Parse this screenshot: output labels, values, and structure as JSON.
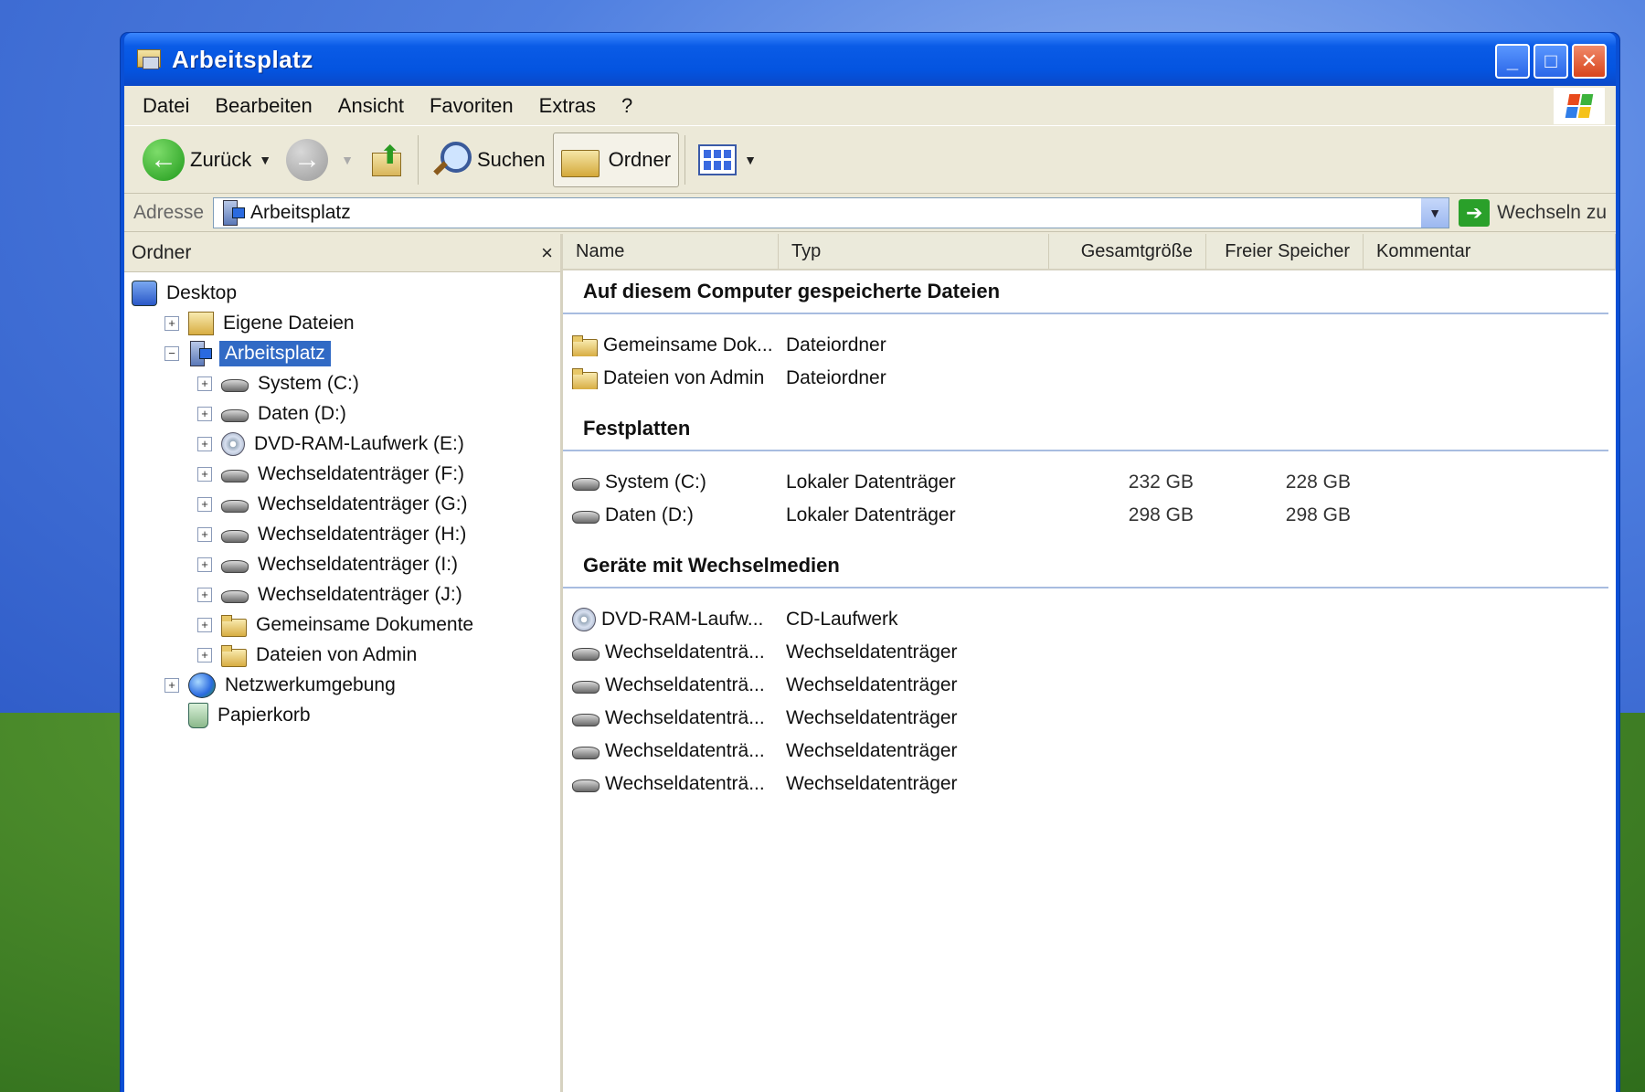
{
  "window": {
    "title": "Arbeitsplatz"
  },
  "menu": [
    "Datei",
    "Bearbeiten",
    "Ansicht",
    "Favoriten",
    "Extras",
    "?"
  ],
  "toolbar": {
    "back": "Zurück",
    "search": "Suchen",
    "folders": "Ordner"
  },
  "address": {
    "label": "Adresse",
    "value": "Arbeitsplatz",
    "go": "Wechseln zu"
  },
  "tree": {
    "header": "Ordner",
    "close": "×",
    "items": [
      {
        "label": "Desktop",
        "icon": "desktop-icon",
        "level": 0,
        "expander": ""
      },
      {
        "label": "Eigene Dateien",
        "icon": "my-documents-icon",
        "level": 1,
        "expander": "+"
      },
      {
        "label": "Arbeitsplatz",
        "icon": "my-computer-icon",
        "level": 1,
        "expander": "−",
        "selected": true
      },
      {
        "label": "System (C:)",
        "icon": "drive-icon",
        "level": 2,
        "expander": "+"
      },
      {
        "label": "Daten (D:)",
        "icon": "drive-icon",
        "level": 2,
        "expander": "+"
      },
      {
        "label": "DVD-RAM-Laufwerk (E:)",
        "icon": "cd-drive-icon",
        "level": 2,
        "expander": "+"
      },
      {
        "label": "Wechseldatenträger (F:)",
        "icon": "drive-icon",
        "level": 2,
        "expander": "+"
      },
      {
        "label": "Wechseldatenträger (G:)",
        "icon": "drive-icon",
        "level": 2,
        "expander": "+"
      },
      {
        "label": "Wechseldatenträger (H:)",
        "icon": "drive-icon",
        "level": 2,
        "expander": "+"
      },
      {
        "label": "Wechseldatenträger (I:)",
        "icon": "drive-icon",
        "level": 2,
        "expander": "+"
      },
      {
        "label": "Wechseldatenträger (J:)",
        "icon": "drive-icon",
        "level": 2,
        "expander": "+"
      },
      {
        "label": "Gemeinsame Dokumente",
        "icon": "folder-icon",
        "level": 2,
        "expander": "+"
      },
      {
        "label": "Dateien von Admin",
        "icon": "folder-icon",
        "level": 2,
        "expander": "+"
      },
      {
        "label": "Netzwerkumgebung",
        "icon": "network-icon",
        "level": 1,
        "expander": "+"
      },
      {
        "label": "Papierkorb",
        "icon": "recycle-bin-icon",
        "level": 1,
        "expander": ""
      }
    ]
  },
  "list": {
    "columns": [
      "Name",
      "Typ",
      "Gesamtgröße",
      "Freier Speicher",
      "Kommentar"
    ],
    "groups": [
      {
        "title": "Auf diesem Computer gespeicherte Dateien",
        "rows": [
          {
            "name": "Gemeinsame Dok...",
            "type": "Dateiordner",
            "size": "",
            "free": "",
            "icon": "folder-icon"
          },
          {
            "name": "Dateien von Admin",
            "type": "Dateiordner",
            "size": "",
            "free": "",
            "icon": "folder-icon"
          }
        ]
      },
      {
        "title": "Festplatten",
        "rows": [
          {
            "name": "System (C:)",
            "type": "Lokaler Datenträger",
            "size": "232 GB",
            "free": "228 GB",
            "icon": "drive-icon"
          },
          {
            "name": "Daten (D:)",
            "type": "Lokaler Datenträger",
            "size": "298 GB",
            "free": "298 GB",
            "icon": "drive-icon"
          }
        ]
      },
      {
        "title": "Geräte mit Wechselmedien",
        "rows": [
          {
            "name": "DVD-RAM-Laufw...",
            "type": "CD-Laufwerk",
            "size": "",
            "free": "",
            "icon": "cd-drive-icon"
          },
          {
            "name": "Wechseldatenträ...",
            "type": "Wechseldatenträger",
            "size": "",
            "free": "",
            "icon": "drive-icon"
          },
          {
            "name": "Wechseldatenträ...",
            "type": "Wechseldatenträger",
            "size": "",
            "free": "",
            "icon": "drive-icon"
          },
          {
            "name": "Wechseldatenträ...",
            "type": "Wechseldatenträger",
            "size": "",
            "free": "",
            "icon": "drive-icon"
          },
          {
            "name": "Wechseldatenträ...",
            "type": "Wechseldatenträger",
            "size": "",
            "free": "",
            "icon": "drive-icon"
          },
          {
            "name": "Wechseldatenträ...",
            "type": "Wechseldatenträger",
            "size": "",
            "free": "",
            "icon": "drive-icon"
          }
        ]
      }
    ]
  },
  "colors": {
    "titlebar": "#0454e0",
    "selection": "#316ac5",
    "client": "#ece9d8"
  }
}
